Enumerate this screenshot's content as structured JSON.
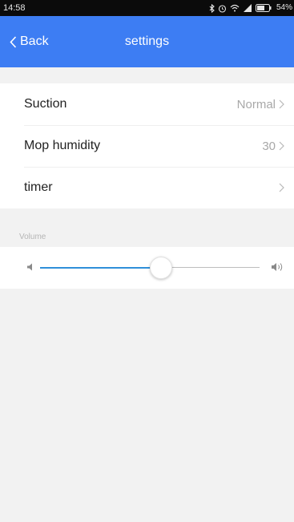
{
  "status_bar": {
    "time": "14:58",
    "battery": "54%",
    "icons": [
      "bluetooth-icon",
      "alarm-icon",
      "wifi-icon",
      "signal-icon",
      "battery-icon"
    ]
  },
  "header": {
    "back_label": "Back",
    "title": "settings",
    "background_color": "#3d7df3"
  },
  "settings": {
    "items": [
      {
        "label": "Suction",
        "value": "Normal"
      },
      {
        "label": "Mop humidity",
        "value": "30"
      },
      {
        "label": "timer",
        "value": ""
      }
    ]
  },
  "volume": {
    "label": "Volume",
    "level": 0.55,
    "accent_color": "#2f8fd9"
  }
}
